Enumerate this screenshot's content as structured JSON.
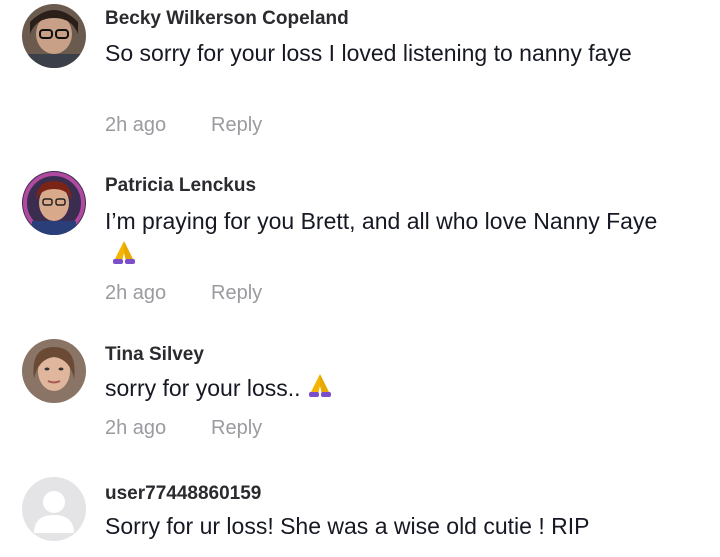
{
  "comments": [
    {
      "username": "Becky Wilkerson Copeland",
      "text": "So sorry for your loss I loved listening to nanny faye",
      "time": "2h ago",
      "reply_label": "Reply",
      "avatar_icon": "user-photo-avatar",
      "emoji": ""
    },
    {
      "username": "Patricia Lenckus",
      "text": "I’m praying for you Brett, and all who love Nanny Faye",
      "time": "2h ago",
      "reply_label": "Reply",
      "avatar_icon": "user-photo-avatar",
      "emoji": "folded-hands-icon"
    },
    {
      "username": "Tina Silvey",
      "text": "sorry for your loss..",
      "time": "2h ago",
      "reply_label": "Reply",
      "avatar_icon": "user-photo-avatar",
      "emoji": "folded-hands-icon"
    },
    {
      "username": "user77448860159",
      "text": "Sorry for ur loss! She was a wise old cutie ! RIP",
      "time": "",
      "reply_label": "",
      "avatar_icon": "default-avatar-icon",
      "emoji": ""
    }
  ],
  "colors": {
    "text": "#161823",
    "meta": "#9a9aa0",
    "emoji": "#f4b400"
  }
}
